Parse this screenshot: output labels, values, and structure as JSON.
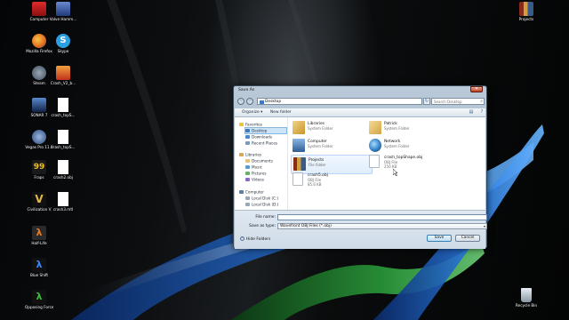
{
  "desktop_icons": [
    {
      "label": "Computer",
      "icon": "computer-icon",
      "color": "#c61a1a"
    },
    {
      "label": "Valve Hamm...",
      "icon": "hammer-icon",
      "color": "#3a5fa8"
    },
    {
      "label": "Mozilla Firefox",
      "icon": "firefox-icon",
      "color": "#e36b1c"
    },
    {
      "label": "Skype",
      "icon": "skype-icon",
      "color": "#2b9fe0"
    },
    {
      "label": "Steam",
      "icon": "steam-icon",
      "color": "#3f4c5c"
    },
    {
      "label": "Crash_V2_b...",
      "icon": "file-icon",
      "color": "#d24a1a"
    },
    {
      "label": "SONAR 7",
      "icon": "sonar-icon",
      "color": "#1f3c6e"
    },
    {
      "label": "crash_topS...",
      "icon": "document-icon",
      "color": "#ffffff"
    },
    {
      "label": "Vegas Pro 11.0",
      "icon": "vegas-icon",
      "color": "#2c4a7a"
    },
    {
      "label": "crash_topS...",
      "icon": "document-icon",
      "color": "#ffffff"
    },
    {
      "label": "Fraps",
      "icon": "fraps-icon",
      "color": "#d6a11a"
    },
    {
      "label": "crash2.obj",
      "icon": "document-icon",
      "color": "#ffffff"
    },
    {
      "label": "Civilization V",
      "icon": "civ-icon",
      "color": "#caa23a"
    },
    {
      "label": "crash3.mtl",
      "icon": "document-icon",
      "color": "#ffffff"
    },
    {
      "label": "Half-Life",
      "icon": "halflife-icon",
      "color": "#e06a12"
    },
    {
      "label": "Blue Shift",
      "icon": "blueshift-icon",
      "color": "#2b6fcf"
    },
    {
      "label": "Opposing Force",
      "icon": "opposingforce-icon",
      "color": "#3aa03a"
    },
    {
      "label": "Projects",
      "icon": "books-icon",
      "color": "#8a3a2a"
    },
    {
      "label": "Recycle Bin",
      "icon": "recycle-bin-icon",
      "color": "#9aa6b2"
    }
  ],
  "dialog": {
    "title": "Save As",
    "address": "Desktop",
    "search_placeholder": "Search Desktop",
    "toolbar": {
      "organize": "Organize ▾",
      "new_folder": "New folder"
    },
    "nav": {
      "favorites": "Favorites",
      "desktop": "Desktop",
      "downloads": "Downloads",
      "recent_places": "Recent Places",
      "libraries": "Libraries",
      "documents": "Documents",
      "music": "Music",
      "pictures": "Pictures",
      "videos": "Videos",
      "computer": "Computer",
      "local_disk_c": "Local Disk (C:)",
      "local_disk_d": "Local Disk (D:)"
    },
    "files": [
      {
        "name": "Libraries",
        "type": "System Folder",
        "size": "",
        "icon": "libraries-icon"
      },
      {
        "name": "Patrick",
        "type": "System Folder",
        "size": "",
        "icon": "user-folder-icon"
      },
      {
        "name": "Computer",
        "type": "System Folder",
        "size": "",
        "icon": "computer-icon"
      },
      {
        "name": "Network",
        "type": "System Folder",
        "size": "",
        "icon": "network-icon"
      },
      {
        "name": "Projects",
        "type": "File folder",
        "size": "",
        "icon": "books-icon"
      },
      {
        "name": "crash_topShape.obj",
        "type": "OBJ File",
        "size": "250 KB",
        "icon": "document-icon"
      },
      {
        "name": "crash5.obj",
        "type": "OBJ File",
        "size": "85.6 KB",
        "icon": "document-icon"
      }
    ],
    "file_name_label": "File name:",
    "file_name_value": "",
    "save_type_label": "Save as type:",
    "save_type_value": "Wavefront OBJ Files (*.obj)",
    "hide_folders": "Hide Folders",
    "save": "Save",
    "cancel": "Cancel"
  }
}
